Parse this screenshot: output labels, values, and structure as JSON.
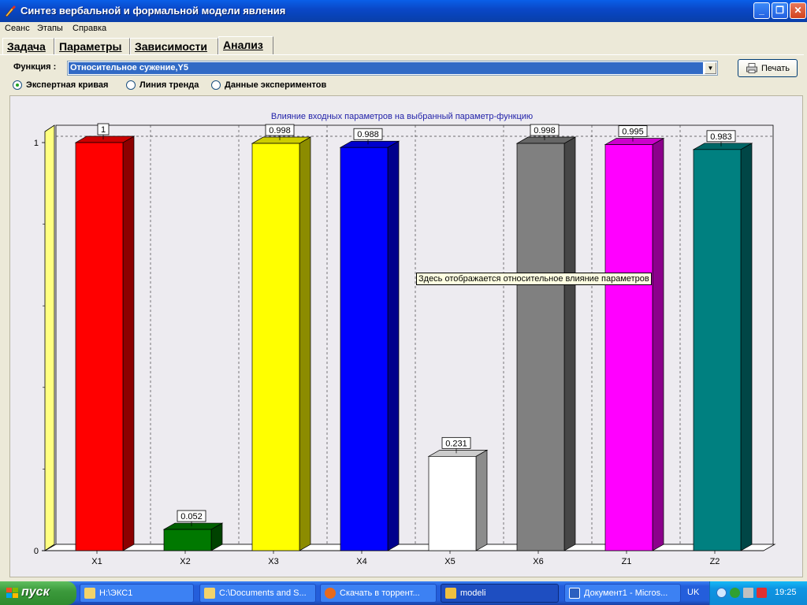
{
  "window": {
    "title": "Синтез вербальной и формальной модели явления"
  },
  "menu": [
    "Сеанс",
    "Этапы",
    "Справка"
  ],
  "tabs": [
    "Задача",
    "Параметры",
    "Зависимости",
    "Анализ"
  ],
  "function": {
    "label": "Функция :",
    "value": "Относительное сужение,Y5"
  },
  "print_label": "Печать",
  "radios": [
    {
      "label": "Экспертная кривая",
      "selected": true
    },
    {
      "label": "Линия тренда",
      "selected": false
    },
    {
      "label": "Данные экспериментов",
      "selected": false
    }
  ],
  "tooltip": "Здесь отображается относительное влияние параметров",
  "chart_data": {
    "type": "bar",
    "title": "Влияние входных параметров на  выбранный параметр-функцию",
    "categories": [
      "X1",
      "X2",
      "X3",
      "X4",
      "X5",
      "X6",
      "Z1",
      "Z2"
    ],
    "values": [
      1,
      0.052,
      0.998,
      0.988,
      0.231,
      0.998,
      0.995,
      0.983
    ],
    "value_labels": [
      "1",
      "0.052",
      "0.998",
      "0.988",
      "0.231",
      "0.998",
      "0.995",
      "0.983"
    ],
    "colors": [
      "#ff0000",
      "#007800",
      "#ffff00",
      "#0000ff",
      "#ffffff",
      "#808080",
      "#ff00ff",
      "#008080"
    ],
    "yticks": [
      "0",
      "1"
    ],
    "ylim": [
      0,
      1
    ],
    "grid": true,
    "style": "3d"
  },
  "taskbar": {
    "start_label": "пуск",
    "tasks": [
      {
        "label": "H:\\ЭКС1",
        "active": false
      },
      {
        "label": "C:\\Documents and S...",
        "active": false
      },
      {
        "label": "Скачать в торрент...",
        "active": false
      },
      {
        "label": "modeli",
        "active": true
      },
      {
        "label": "Документ1 - Micros...",
        "active": false
      }
    ],
    "lang": "UK",
    "clock": "19:25"
  }
}
